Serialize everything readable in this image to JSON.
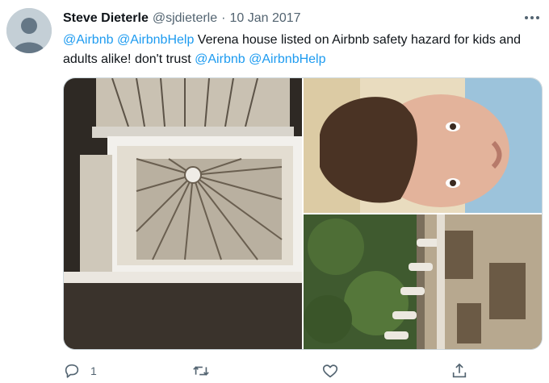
{
  "tweet": {
    "display_name": "Steve Dieterle",
    "handle": "@sjdieterle",
    "separator": "·",
    "date": "10 Jan 2017",
    "text_parts": {
      "m1": "@Airbnb",
      "m2": "@AirbnbHelp",
      "t1": " Verena house listed on Airbnb safety hazard for kids and adults alike!  don't trust ",
      "m3": "@Airbnb",
      "m4": "@AirbnbHelp"
    }
  },
  "actions": {
    "reply_count": "1",
    "retweet_count": "",
    "like_count": ""
  },
  "icons": {
    "more": "more-dots-icon",
    "reply": "reply-icon",
    "retweet": "retweet-icon",
    "like": "heart-icon",
    "share": "share-icon"
  },
  "colors": {
    "link": "#1d9bf0",
    "secondary": "#536471",
    "text": "#0f1419"
  }
}
